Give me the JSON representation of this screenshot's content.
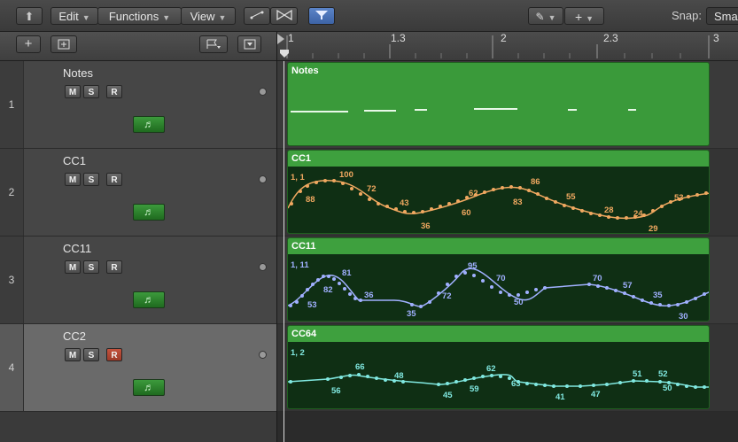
{
  "toolbar": {
    "edit_label": "Edit",
    "functions_label": "Functions",
    "view_label": "View",
    "snap_label": "Snap:",
    "snap_value": "Sma"
  },
  "ruler": {
    "marks": [
      "1",
      "1.3",
      "2",
      "2.3",
      "3"
    ]
  },
  "tracks": [
    {
      "number": "1",
      "name": "Notes",
      "m": "M",
      "s": "S",
      "r": "R",
      "selected": false,
      "record_on": false
    },
    {
      "number": "2",
      "name": "CC1",
      "m": "M",
      "s": "S",
      "r": "R",
      "selected": false,
      "record_on": false
    },
    {
      "number": "3",
      "name": "CC11",
      "m": "M",
      "s": "S",
      "r": "R",
      "selected": false,
      "record_on": false
    },
    {
      "number": "4",
      "name": "CC2",
      "m": "M",
      "s": "S",
      "r": "R",
      "selected": true,
      "record_on": true
    }
  ],
  "regions": [
    {
      "title": "Notes"
    },
    {
      "title": "CC1",
      "channel_label": "1, 1",
      "color": "#f0a860",
      "points": [
        [
          "0.00",
          88
        ],
        [
          "0.05",
          100
        ],
        [
          "0.18",
          72
        ],
        [
          "0.28",
          43
        ],
        [
          "0.33",
          36
        ],
        [
          "0.42",
          60
        ],
        [
          "0.45",
          62
        ],
        [
          "0.55",
          83
        ],
        [
          "0.58",
          86
        ],
        [
          "0.68",
          55
        ],
        [
          "0.78",
          28
        ],
        [
          "0.85",
          24
        ],
        [
          "0.87",
          29
        ],
        [
          "0.98",
          53
        ]
      ],
      "values": [
        "88",
        "100",
        "72",
        "43",
        "36",
        "60",
        "62",
        "83",
        "86",
        "55",
        "28",
        "24",
        "29",
        "53"
      ]
    },
    {
      "title": "CC11",
      "channel_label": "1, 11",
      "color": "#a0b0ff",
      "points": [],
      "values": [
        "53",
        "82",
        "81",
        "36",
        "35",
        "72",
        "95",
        "70",
        "50",
        "70",
        "57",
        "35",
        "30"
      ]
    },
    {
      "title": "CC64",
      "channel_label": "1, 2",
      "color": "#80e8e0",
      "points": [],
      "values": [
        "56",
        "66",
        "48",
        "45",
        "59",
        "62",
        "63",
        "41",
        "47",
        "51",
        "52",
        "50"
      ]
    }
  ]
}
